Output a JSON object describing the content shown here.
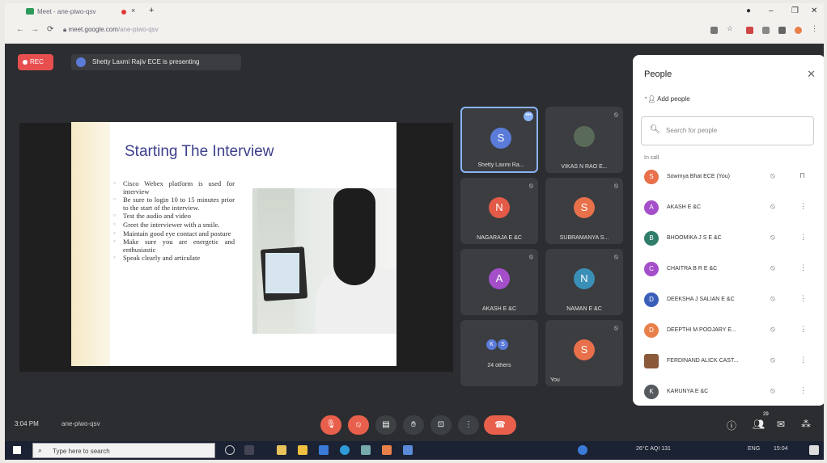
{
  "browser": {
    "tab_title": "Meet - ane-piwo-qsv",
    "tab_close": "×",
    "new_tab": "+",
    "url_host": "meet.google.com",
    "url_path": "/ane-piwo-qsv"
  },
  "meet": {
    "rec_label": "REC",
    "presenting_text": "Shetty Laxmi Rajiv ECE is presenting",
    "slide": {
      "title": "Starting The Interview",
      "bullets": [
        "Cisco Webex platform is used for interview",
        "Be sure to login 10 to 15 minutes prior to the start of the interview.",
        "Test the audio and video",
        "Greet the interviewer with a smile.",
        "Maintain good eye contact and posture",
        "Make sure you are energetic and enthusiastic",
        "Speak clearly and articulate"
      ]
    },
    "tiles": [
      {
        "initial": "S",
        "name": "Shetty Laxmi Ra...",
        "color": "#5b7bd8"
      },
      {
        "initial": "",
        "name": "VIKAS N RAO E...",
        "color": "#5a6a5a"
      },
      {
        "initial": "N",
        "name": "NAGARAJA E &C",
        "color": "#e35a48"
      },
      {
        "initial": "S",
        "name": "SUBRAMANYA S...",
        "color": "#e8704a"
      },
      {
        "initial": "A",
        "name": "AKASH E &C",
        "color": "#a44fc9"
      },
      {
        "initial": "N",
        "name": "NAMAN E &C",
        "color": "#3a8fb7"
      },
      {
        "initial": "",
        "name": "24 others",
        "color": "#5b7bd8"
      },
      {
        "initial": "S",
        "name": "You",
        "color": "#e8704a"
      }
    ],
    "others_initials": [
      "K",
      "S"
    ]
  },
  "people_panel": {
    "title": "People",
    "add_people": "Add people",
    "search_placeholder": "Search for people",
    "in_call": "In call",
    "participants": [
      {
        "initial": "S",
        "name": "Sowmya Bhat ECE (You)",
        "color": "#e8704a"
      },
      {
        "initial": "A",
        "name": "AKASH E &C",
        "color": "#a44fc9"
      },
      {
        "initial": "B",
        "name": "BHOOMIKA J S E &C",
        "color": "#2f7d6a"
      },
      {
        "initial": "C",
        "name": "CHAITRA B R E &C",
        "color": "#a44fc9"
      },
      {
        "initial": "D",
        "name": "DEEKSHA J SALIAN E &C",
        "color": "#3b5fb8"
      },
      {
        "initial": "D",
        "name": "DEEPTHI M POOJARY E...",
        "color": "#e8804a"
      },
      {
        "initial": "",
        "name": "FERDINAND ALICK CAST...",
        "color": "#8a5a3a"
      },
      {
        "initial": "K",
        "name": "KARUNYA E &C",
        "color": "#555a5e"
      }
    ]
  },
  "bottom_bar": {
    "time": "3:04 PM",
    "meeting_code": "ane-piwo-qsv",
    "participant_count": "29"
  },
  "taskbar": {
    "search_placeholder": "Type here to search",
    "weather": "26°C  AQI 131",
    "lang": "ENG",
    "clock": "15:04"
  },
  "colors": {
    "meet_bg": "#2b2d30",
    "accent": "#8ab4f8",
    "danger": "#e8604c"
  }
}
